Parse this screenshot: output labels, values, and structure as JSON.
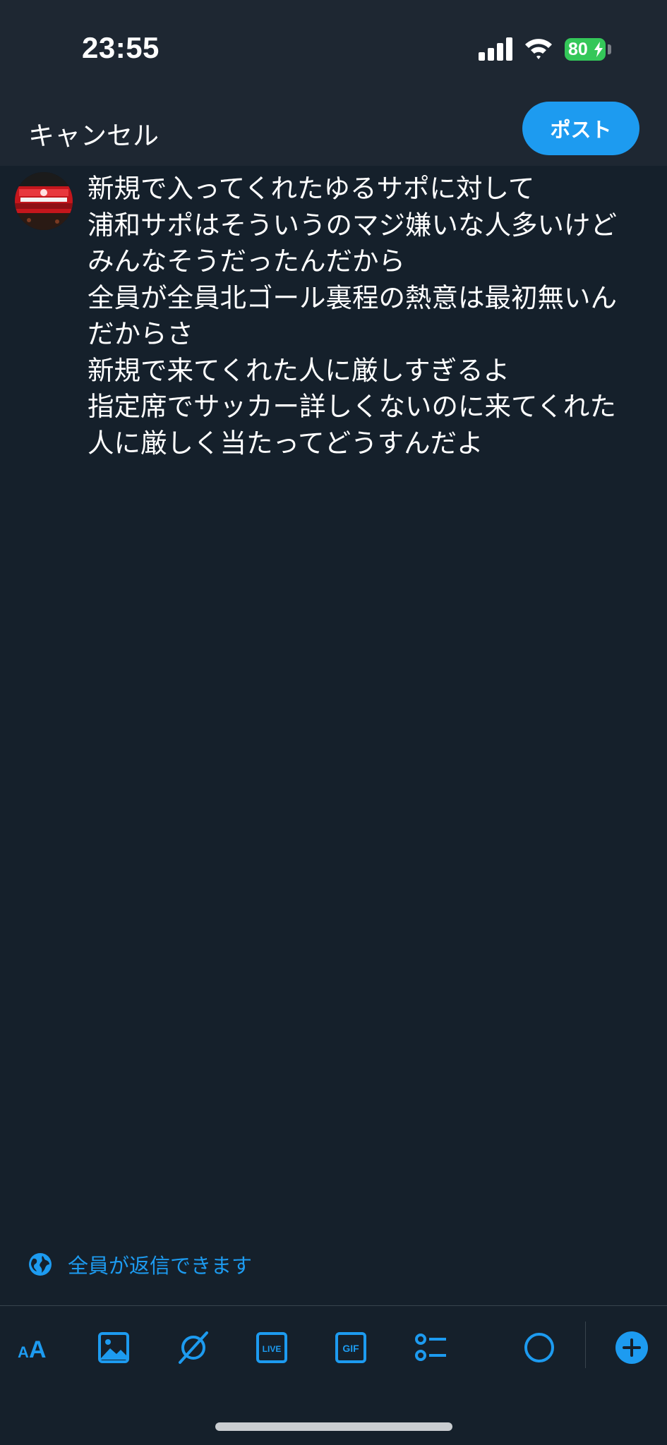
{
  "status_bar": {
    "time": "23:55",
    "battery_percent": "80",
    "icons": [
      "signal-icon",
      "wifi-icon",
      "battery-charging-icon"
    ]
  },
  "header": {
    "cancel_label": "キャンセル",
    "post_label": "ポスト"
  },
  "compose": {
    "avatar_icon": "avatar",
    "text": "新規で入ってくれたゆるサポに対して\n浦和サポはそういうのマジ嫌いな人多いけど\nみんなそうだったんだから\n全員が全員北ゴール裏程の熱意は最初無いんだからさ\n新規で来てくれた人に厳しすぎるよ\n指定席でサッカー詳しくないのに来てくれた人に厳しく当たってどうすんだよ"
  },
  "reply_settings": {
    "icon": "globe-icon",
    "label": "全員が返信できます"
  },
  "toolbar": {
    "items": [
      {
        "icon": "text-size-icon",
        "label": "AA"
      },
      {
        "icon": "image-icon"
      },
      {
        "icon": "grok-icon"
      },
      {
        "icon": "live-icon",
        "label": "LIVE"
      },
      {
        "icon": "gif-icon",
        "label": "GIF"
      },
      {
        "icon": "poll-icon"
      },
      {
        "icon": "character-count-icon"
      },
      {
        "icon": "add-post-icon"
      }
    ]
  },
  "colors": {
    "background": "#15202b",
    "header": "#1e2732",
    "accent": "#1d9bf0",
    "battery": "#34c759"
  }
}
